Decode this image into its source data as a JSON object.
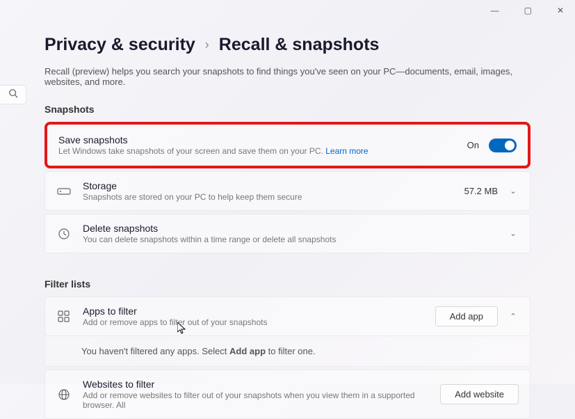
{
  "window": {
    "minimize": "—",
    "maximize": "▢",
    "close": "✕"
  },
  "breadcrumb": {
    "parent": "Privacy & security",
    "separator": "›",
    "current": "Recall & snapshots"
  },
  "description": "Recall (preview) helps you search your snapshots to find things you've seen on your PC—documents, email, images, websites, and more.",
  "sections": {
    "snapshots": {
      "header": "Snapshots",
      "save": {
        "title": "Save snapshots",
        "subtitle": "Let Windows take snapshots of your screen and save them on your PC.",
        "learn_more": "Learn more",
        "state_label": "On",
        "state": true
      },
      "storage": {
        "title": "Storage",
        "subtitle": "Snapshots are stored on your PC to help keep them secure",
        "value": "57.2 MB"
      },
      "delete": {
        "title": "Delete snapshots",
        "subtitle": "You can delete snapshots within a time range or delete all snapshots"
      }
    },
    "filters": {
      "header": "Filter lists",
      "apps": {
        "title": "Apps to filter",
        "subtitle": "Add or remove apps to filter out of your snapshots",
        "button": "Add app",
        "message_prefix": "You haven't filtered any apps. Select ",
        "message_bold": "Add app",
        "message_suffix": " to filter one."
      },
      "websites": {
        "title": "Websites to filter",
        "subtitle": "Add or remove websites to filter out of your snapshots when you view them in a supported browser. All",
        "button": "Add website"
      }
    }
  }
}
